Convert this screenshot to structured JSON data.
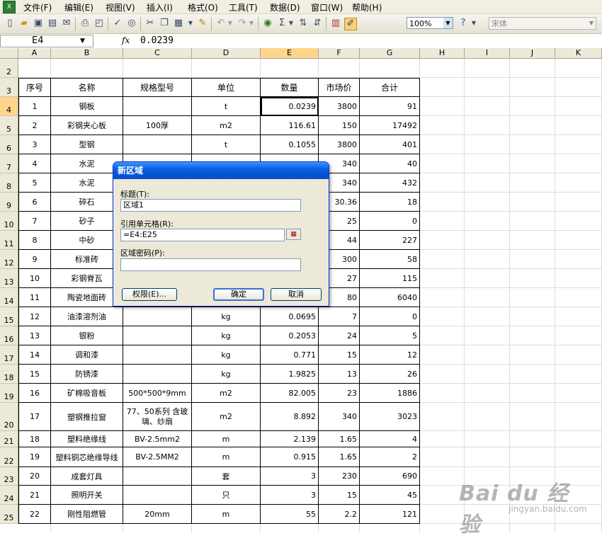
{
  "menu": [
    "文件(F)",
    "编辑(E)",
    "视图(V)",
    "插入(I)",
    "格式(O)",
    "工具(T)",
    "数据(D)",
    "窗口(W)",
    "帮助(H)"
  ],
  "toolbar": {
    "zoom": "100%",
    "font": "宋体"
  },
  "formula": {
    "name_box": "E4",
    "fx": "fx",
    "value": "0.0239"
  },
  "columns": [
    "A",
    "B",
    "C",
    "D",
    "E",
    "F",
    "G",
    "H",
    "I",
    "J",
    "K"
  ],
  "row_numbers": [
    "2",
    "3",
    "4",
    "5",
    "6",
    "7",
    "8",
    "9",
    "10",
    "11",
    "12",
    "13",
    "14",
    "15",
    "16",
    "17",
    "18",
    "19",
    "20",
    "21",
    "22",
    "23",
    "24",
    "25"
  ],
  "table": {
    "headers": [
      "序号",
      "名称",
      "规格型号",
      "单位",
      "数量",
      "市场价",
      "合计"
    ],
    "rows": [
      [
        "1",
        "钢板",
        "",
        "t",
        "0.0239",
        "3800",
        "91"
      ],
      [
        "2",
        "彩钢夹心板",
        "100厚",
        "m2",
        "116.61",
        "150",
        "17492"
      ],
      [
        "3",
        "型钢",
        "",
        "t",
        "0.1055",
        "3800",
        "401"
      ],
      [
        "4",
        "水泥",
        "",
        "",
        "",
        "340",
        "40"
      ],
      [
        "5",
        "水泥",
        "",
        "",
        "",
        "340",
        "432"
      ],
      [
        "6",
        "碎石",
        "",
        "",
        "",
        "30.36",
        "18"
      ],
      [
        "7",
        "砂子",
        "",
        "",
        "",
        "25",
        "0"
      ],
      [
        "8",
        "中砂",
        "",
        "",
        "",
        "44",
        "227"
      ],
      [
        "9",
        "标准砖",
        "",
        "",
        "",
        "300",
        "58"
      ],
      [
        "10",
        "彩钢脊瓦",
        "",
        "",
        "",
        "27",
        "115"
      ],
      [
        "11",
        "陶瓷地面砖",
        "",
        "",
        "",
        "80",
        "6040"
      ],
      [
        "12",
        "油漆溶剂油",
        "",
        "kg",
        "0.0695",
        "7",
        "0"
      ],
      [
        "13",
        "银粉",
        "",
        "kg",
        "0.2053",
        "24",
        "5"
      ],
      [
        "14",
        "调和漆",
        "",
        "kg",
        "0.771",
        "15",
        "12"
      ],
      [
        "15",
        "防锈漆",
        "",
        "kg",
        "1.9825",
        "13",
        "26"
      ],
      [
        "16",
        "矿棉吸音板",
        "500*500*9mm",
        "m2",
        "82.005",
        "23",
        "1886"
      ],
      [
        "17",
        "塑钢推拉窗",
        "77、50系列 含玻璃、纱扇",
        "m2",
        "8.892",
        "340",
        "3023"
      ],
      [
        "18",
        "塑料绝缘线",
        "BV-2.5mm2",
        "m",
        "2.139",
        "1.65",
        "4"
      ],
      [
        "19",
        "塑料铜芯绝缘导线",
        "BV-2.5MM2",
        "m",
        "0.915",
        "1.65",
        "2"
      ],
      [
        "20",
        "成套灯具",
        "",
        "套",
        "3",
        "230",
        "690"
      ],
      [
        "21",
        "照明开关",
        "",
        "只",
        "3",
        "15",
        "45"
      ],
      [
        "22",
        "刚性阻燃管",
        "20mm",
        "m",
        "55",
        "2.2",
        "121"
      ]
    ]
  },
  "dialog": {
    "title": "新区域",
    "title_label": "标题(T):",
    "title_value": "区域1",
    "ref_label": "引用单元格(R):",
    "ref_value": "=E4:E25",
    "password_label": "区域密码(P):",
    "password_value": "",
    "perm_button": "权限(E)...",
    "ok_button": "确定",
    "cancel_button": "取消"
  },
  "watermark": {
    "logo": "Bai du 经验",
    "url": "jingyan.baidu.com"
  }
}
